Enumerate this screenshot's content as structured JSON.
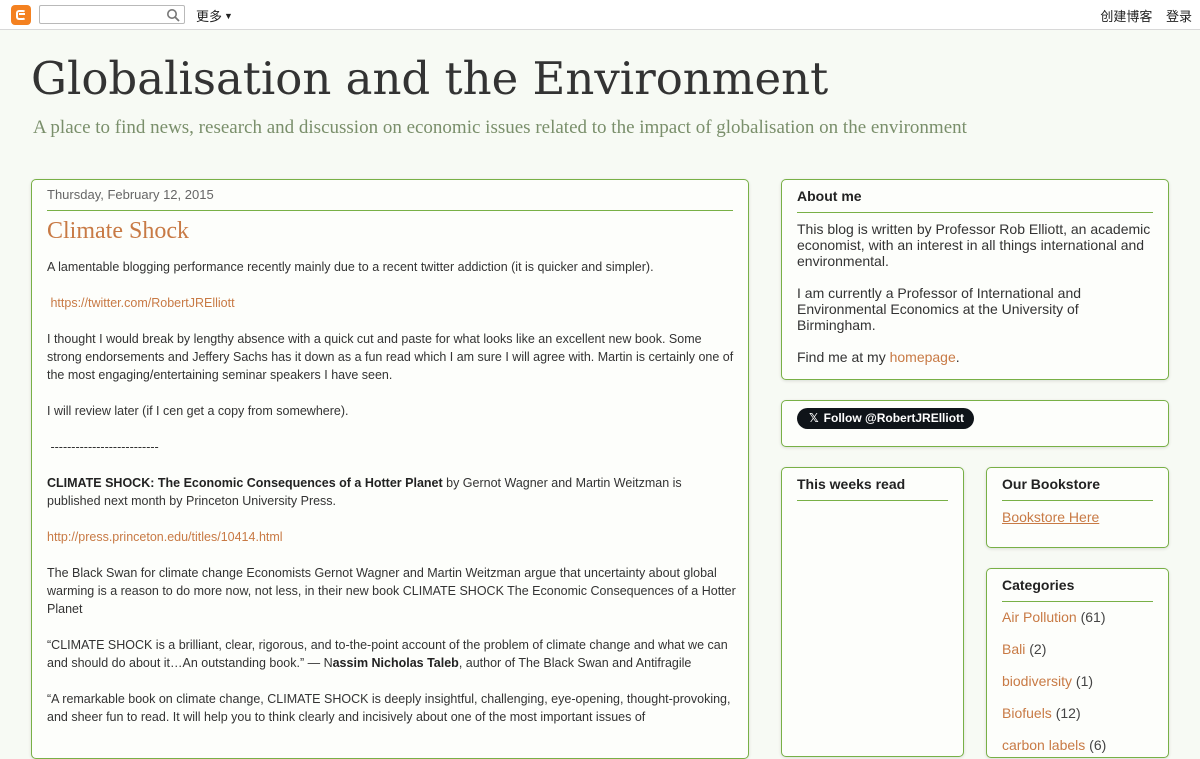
{
  "navbar": {
    "search_placeholder": "",
    "more_label": "更多",
    "create_blog": "创建博客",
    "login": "登录"
  },
  "header": {
    "title": "Globalisation and the Environment",
    "description": "A place to find news, research and discussion on economic issues related to the impact of globalisation on the environment"
  },
  "post": {
    "date": "Thursday, February 12, 2015",
    "title": "Climate Shock",
    "p1": "A lamentable blogging performance recently mainly due to a recent twitter addiction (it is quicker and simpler).",
    "twitter_link": "https://twitter.com/RobertJRElliott",
    "p2": "I thought I would break by lengthy absence with a quick cut and paste for what looks like an excellent new book. Some strong endorsements and Jeffery Sachs has it down as a fun read which I am sure I will agree with. Martin is certainly one of the most engaging/entertaining seminar speakers I have seen.",
    "p3": "I will review later (if I cen get a copy from somewhere).",
    "divider": "--------------------------",
    "book_title": "CLIMATE SHOCK: The Economic Consequences of a Hotter Planet",
    "book_rest": " by Gernot Wagner and Martin Weitzman is published next month by Princeton University Press.",
    "press_link": "http://press.princeton.edu/titles/10414.html",
    "p4": "The Black Swan for climate change Economists Gernot Wagner and Martin Weitzman argue that uncertainty about global warming is a reason to do more now, not less, in their new book CLIMATE SHOCK The Economic Consequences of a Hotter Planet",
    "quote1_text": "“CLIMATE SHOCK is a brilliant, clear, rigorous, and to-the-point account of the problem of climate change and what we can and should do about it…An outstanding book.” — N",
    "quote1_author": "assim Nicholas Taleb",
    "quote1_rest": ", author of The Black Swan and Antifragile",
    "quote2_text": " “A remarkable book on climate change, CLIMATE SHOCK is deeply insightful, challenging, eye-opening, thought-provoking, and sheer fun to read. It will help you to think clearly and incisively about one of the most important issues of"
  },
  "sidebar": {
    "about": {
      "title": "About me",
      "p1": "This blog is written by Professor Rob Elliott, an academic economist, with an interest in all things international and environmental.",
      "p2": "I am currently a Professor of International and Environmental Economics at the University of Birmingham.",
      "p3_prefix": "Find me at my ",
      "p3_link": "homepage",
      "p3_suffix": "."
    },
    "follow_label": "Follow @RobertJRElliott",
    "week_title": "This weeks read",
    "store_title": "Our Bookstore",
    "store_link": "Bookstore Here",
    "categories_title": "Categories",
    "categories": [
      {
        "name": "Air Pollution",
        "count": "(61)"
      },
      {
        "name": "Bali",
        "count": "(2)"
      },
      {
        "name": "biodiversity",
        "count": "(1)"
      },
      {
        "name": "Biofuels",
        "count": "(12)"
      },
      {
        "name": "carbon labels",
        "count": "(6)"
      }
    ]
  }
}
